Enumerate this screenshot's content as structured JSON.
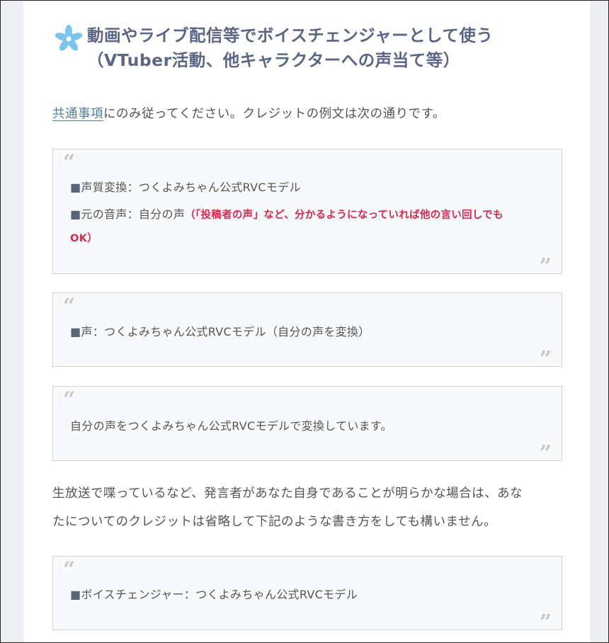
{
  "heading": {
    "line1": "動画やライブ配信等でボイスチェンジャーとして使う",
    "line2": "（VTuber活動、他キャラクターへの声当て等）"
  },
  "intro": {
    "link": "共通事項",
    "rest": "にのみ従ってください。クレジットの例文は次の通りです。"
  },
  "quote1": {
    "line1_square": "■",
    "line1": "声質変換：つくよみちゃん公式RVCモデル",
    "line2_square": "■",
    "line2": "元の音声：自分の声",
    "line2_note": "（「投稿者の声」など、分かるようになっていれば他の言い回しでも",
    "line3_note": "OK）"
  },
  "quote2": {
    "square": "■",
    "text": "声：つくよみちゃん公式RVCモデル（自分の声を変換）"
  },
  "quote3": {
    "text": "自分の声をつくよみちゃん公式RVCモデルで変換しています。"
  },
  "para2": {
    "line1": "生放送で喋っているなど、発言者があなた自身であることが明らかな場合は、あな",
    "line2": "たについてのクレジットは省略して下記のような書き方をしても構いません。"
  },
  "quote4": {
    "square": "■",
    "text": "ボイスチェンジャー：つくよみちゃん公式RVCモデル"
  },
  "quote_marks": {
    "open": "“",
    "close": "”"
  },
  "colors": {
    "accent": "#5b6687",
    "link": "#4d7ea0",
    "note_red": "#d9274d",
    "flower": "#7cc4f0"
  }
}
